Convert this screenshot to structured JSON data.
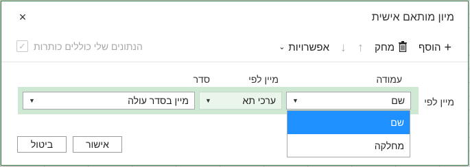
{
  "dialog": {
    "title": "מיון מותאם אישית",
    "close_glyph": "×"
  },
  "toolbar": {
    "add_label": "הוסף",
    "delete_label": "מחק",
    "options_label": "אפשרויות",
    "headers_label": "הנתונים שלי כוללים כותרות",
    "headers_checked": true
  },
  "columns": {
    "column_header": "עמודה",
    "sorton_header": "מיין לפי",
    "order_header": "סדר"
  },
  "row": {
    "label": "מיין לפי",
    "column_value": "שם",
    "sorton_value": "ערכי תא",
    "order_value": "מיין בסדר עולה"
  },
  "dropdown": {
    "items": [
      "שם",
      "מחלקה"
    ],
    "selected_index": 0
  },
  "buttons": {
    "ok": "אישור",
    "cancel": "ביטול"
  },
  "colors": {
    "accent_green": "#3a7d44",
    "row_highlight": "#cfe8d3",
    "selection_blue": "#1e90ff"
  }
}
